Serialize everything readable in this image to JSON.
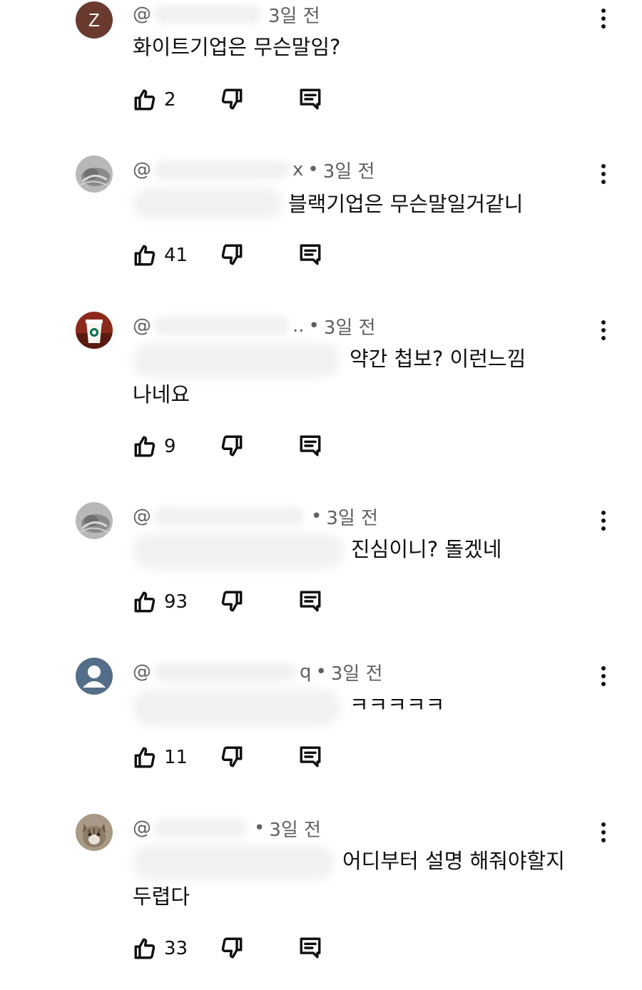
{
  "comments": [
    {
      "avatar_letter": "Z",
      "handle_visible": "@",
      "time": "3일 전",
      "text_line1": "화이트기업은 무슨말임?",
      "text_line2": "",
      "likes": "2"
    },
    {
      "handle_visible": "@",
      "handle_tail": "x",
      "time": "3일 전",
      "text_line1": "블랙기업은 무슨말일거같니",
      "text_line2": "",
      "likes": "41"
    },
    {
      "handle_visible": "@",
      "handle_tail": "..",
      "time": "3일 전",
      "text_line1": "약간 첩보? 이런느낌",
      "text_line2": "나네요",
      "likes": "9"
    },
    {
      "handle_visible": "@",
      "time": "3일 전",
      "text_line1": "진심이니? 돌겠네",
      "text_line2": "",
      "likes": "93"
    },
    {
      "handle_visible": "@",
      "handle_tail": "q",
      "time": "3일 전",
      "text_line1": "ㅋㅋㅋㅋㅋ",
      "text_line2": "",
      "likes": "11"
    },
    {
      "handle_visible": "@",
      "time": "3일 전",
      "text_line1": "어디부터 설명 해줘야할지",
      "text_line2": "두렵다",
      "likes": "33"
    }
  ],
  "colors": {
    "avatar_z": "#6b3a2e",
    "avatar_default": "#546e8a",
    "text_primary": "#0f0f0f",
    "text_secondary": "#606060"
  },
  "icons": {
    "like": "thumbs-up-icon",
    "dislike": "thumbs-down-icon",
    "reply": "reply-comment-icon",
    "menu": "more-vertical-icon"
  }
}
